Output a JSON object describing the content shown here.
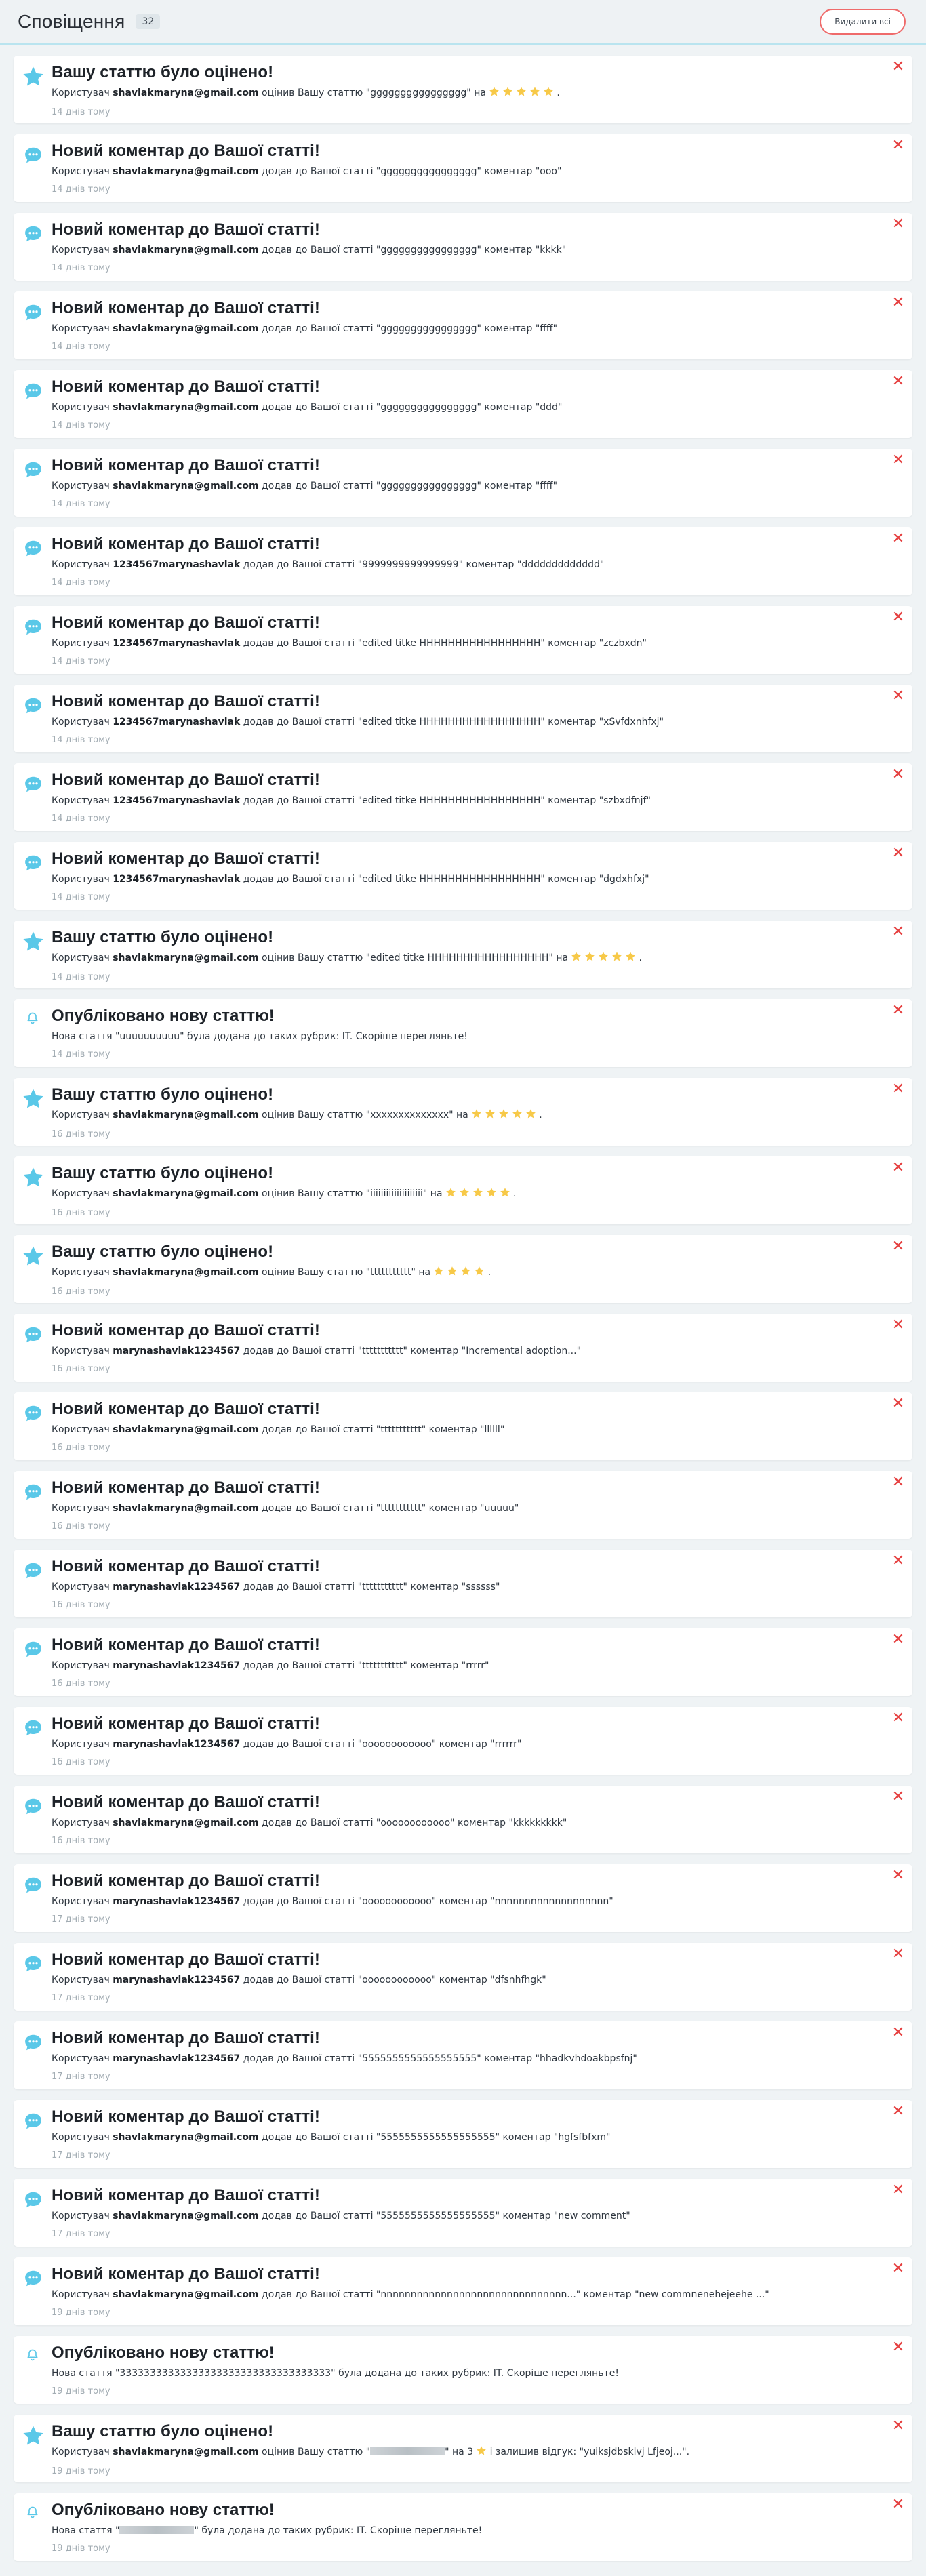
{
  "header": {
    "title": "Сповіщення",
    "count": "32",
    "delete_all": "Видалити всі"
  },
  "colors": {
    "accent": "#5ac8e8",
    "star": "#f7c948",
    "close": "#e53e3e",
    "delete_border": "#ef6b6b",
    "muted": "#a2acb3"
  },
  "notifications": [
    {
      "type": "rating",
      "icon": "star-icon",
      "title": "Вашу статтю було оцінено!",
      "pre": "Користувач",
      "user": "shavlakmaryna@gmail.com",
      "mid": "оцінив Вашу статтю \"gggggggggggggggg\" на",
      "stars": 5,
      "post": ".",
      "time": "14 днів тому"
    },
    {
      "type": "comment",
      "icon": "comment-icon",
      "title": "Новий коментар до Вашої статті!",
      "pre": "Користувач",
      "user": "shavlakmaryna@gmail.com",
      "mid": "додав до Вашої статті \"gggggggggggggggg\" коментар \"ooo\"",
      "time": "14 днів тому"
    },
    {
      "type": "comment",
      "icon": "comment-icon",
      "title": "Новий коментар до Вашої статті!",
      "pre": "Користувач",
      "user": "shavlakmaryna@gmail.com",
      "mid": "додав до Вашої статті \"gggggggggggggggg\" коментар \"kkkk\"",
      "time": "14 днів тому"
    },
    {
      "type": "comment",
      "icon": "comment-icon",
      "title": "Новий коментар до Вашої статті!",
      "pre": "Користувач",
      "user": "shavlakmaryna@gmail.com",
      "mid": "додав до Вашої статті \"gggggggggggggggg\" коментар \"ffff\"",
      "time": "14 днів тому"
    },
    {
      "type": "comment",
      "icon": "comment-icon",
      "title": "Новий коментар до Вашої статті!",
      "pre": "Користувач",
      "user": "shavlakmaryna@gmail.com",
      "mid": "додав до Вашої статті \"gggggggggggggggg\" коментар \"ddd\"",
      "time": "14 днів тому"
    },
    {
      "type": "comment",
      "icon": "comment-icon",
      "title": "Новий коментар до Вашої статті!",
      "pre": "Користувач",
      "user": "shavlakmaryna@gmail.com",
      "mid": "додав до Вашої статті \"gggggggggggggggg\" коментар \"ffff\"",
      "time": "14 днів тому"
    },
    {
      "type": "comment",
      "icon": "comment-icon",
      "title": "Новий коментар до Вашої статті!",
      "pre": "Користувач",
      "user": "1234567marynashavlak",
      "mid": "додав до Вашої статті \"9999999999999999\" коментар \"ddddddddddddd\"",
      "time": "14 днів тому"
    },
    {
      "type": "comment",
      "icon": "comment-icon",
      "title": "Новий коментар до Вашої статті!",
      "pre": "Користувач",
      "user": "1234567marynashavlak",
      "mid": "додав до Вашої статті \"edited titke HHHHHHHHHHHHHHHHH\" коментар \"zczbxdn\"",
      "time": "14 днів тому"
    },
    {
      "type": "comment",
      "icon": "comment-icon",
      "title": "Новий коментар до Вашої статті!",
      "pre": "Користувач",
      "user": "1234567marynashavlak",
      "mid": "додав до Вашої статті \"edited titke HHHHHHHHHHHHHHHHH\" коментар \"xSvfdxnhfxj\"",
      "time": "14 днів тому"
    },
    {
      "type": "comment",
      "icon": "comment-icon",
      "title": "Новий коментар до Вашої статті!",
      "pre": "Користувач",
      "user": "1234567marynashavlak",
      "mid": "додав до Вашої статті \"edited titke HHHHHHHHHHHHHHHHH\" коментар \"szbxdfnjf\"",
      "time": "14 днів тому"
    },
    {
      "type": "comment",
      "icon": "comment-icon",
      "title": "Новий коментар до Вашої статті!",
      "pre": "Користувач",
      "user": "1234567marynashavlak",
      "mid": "додав до Вашої статті \"edited titke HHHHHHHHHHHHHHHHH\" коментар \"dgdxhfxj\"",
      "time": "14 днів тому"
    },
    {
      "type": "rating",
      "icon": "star-icon",
      "title": "Вашу статтю було оцінено!",
      "pre": "Користувач",
      "user": "shavlakmaryna@gmail.com",
      "mid": "оцінив Вашу статтю \"edited titke HHHHHHHHHHHHHHHHH\" на",
      "stars": 5,
      "post": ".",
      "time": "14 днів тому"
    },
    {
      "type": "article",
      "icon": "bell-icon",
      "title": "Опубліковано нову статтю!",
      "pre": "Нова стаття \"uuuuuuuuuu\" була додана до таких рубрик: IT. Скоріше перегляньте!",
      "time": "14 днів тому"
    },
    {
      "type": "rating",
      "icon": "star-icon",
      "title": "Вашу статтю було оцінено!",
      "pre": "Користувач",
      "user": "shavlakmaryna@gmail.com",
      "mid": "оцінив Вашу статтю \"xxxxxxxxxxxxxx\" на",
      "stars": 5,
      "post": ".",
      "time": "16 днів тому"
    },
    {
      "type": "rating",
      "icon": "star-icon",
      "title": "Вашу статтю було оцінено!",
      "pre": "Користувач",
      "user": "shavlakmaryna@gmail.com",
      "mid": "оцінив Вашу статтю \"iiiiiiiiiiiiiiiiiiii\" на",
      "stars": 5,
      "post": ".",
      "time": "16 днів тому"
    },
    {
      "type": "rating",
      "icon": "star-icon",
      "title": "Вашу статтю було оцінено!",
      "pre": "Користувач",
      "user": "shavlakmaryna@gmail.com",
      "mid": "оцінив Вашу статтю \"ttttttttttt\" на",
      "stars": 4,
      "post": ".",
      "time": "16 днів тому"
    },
    {
      "type": "comment",
      "icon": "comment-icon",
      "title": "Новий коментар до Вашої статті!",
      "pre": "Користувач",
      "user": "marynashavlak1234567",
      "mid": "додав до Вашої статті \"ttttttttttt\" коментар \"Incremental adoption...\"",
      "time": "16 днів тому"
    },
    {
      "type": "comment",
      "icon": "comment-icon",
      "title": "Новий коментар до Вашої статті!",
      "pre": "Користувач",
      "user": "shavlakmaryna@gmail.com",
      "mid": "додав до Вашої статті \"ttttttttttt\" коментар \"llllll\"",
      "time": "16 днів тому"
    },
    {
      "type": "comment",
      "icon": "comment-icon",
      "title": "Новий коментар до Вашої статті!",
      "pre": "Користувач",
      "user": "shavlakmaryna@gmail.com",
      "mid": "додав до Вашої статті \"ttttttttttt\" коментар \"uuuuu\"",
      "time": "16 днів тому"
    },
    {
      "type": "comment",
      "icon": "comment-icon",
      "title": "Новий коментар до Вашої статті!",
      "pre": "Користувач",
      "user": "marynashavlak1234567",
      "mid": "додав до Вашої статті \"ttttttttttt\" коментар \"ssssss\"",
      "time": "16 днів тому"
    },
    {
      "type": "comment",
      "icon": "comment-icon",
      "title": "Новий коментар до Вашої статті!",
      "pre": "Користувач",
      "user": "marynashavlak1234567",
      "mid": "додав до Вашої статті \"ttttttttttt\" коментар \"rrrrr\"",
      "time": "16 днів тому"
    },
    {
      "type": "comment",
      "icon": "comment-icon",
      "title": "Новий коментар до Вашої статті!",
      "pre": "Користувач",
      "user": "marynashavlak1234567",
      "mid": "додав до Вашої статті \"oooooooooooo\" коментар \"rrrrrr\"",
      "time": "16 днів тому"
    },
    {
      "type": "comment",
      "icon": "comment-icon",
      "title": "Новий коментар до Вашої статті!",
      "pre": "Користувач",
      "user": "shavlakmaryna@gmail.com",
      "mid": "додав до Вашої статті \"oooooooooooo\" коментар \"kkkkkkkkk\"",
      "time": "16 днів тому"
    },
    {
      "type": "comment",
      "icon": "comment-icon",
      "title": "Новий коментар до Вашої статті!",
      "pre": "Користувач",
      "user": "marynashavlak1234567",
      "mid": "додав до Вашої статті \"oooooooooooo\" коментар \"nnnnnnnnnnnnnnnnnnn\"",
      "time": "17 днів тому"
    },
    {
      "type": "comment",
      "icon": "comment-icon",
      "title": "Новий коментар до Вашої статті!",
      "pre": "Користувач",
      "user": "marynashavlak1234567",
      "mid": "додав до Вашої статті \"oooooooooooo\" коментар \"dfsnhfhgk\"",
      "time": "17 днів тому"
    },
    {
      "type": "comment",
      "icon": "comment-icon",
      "title": "Новий коментар до Вашої статті!",
      "pre": "Користувач",
      "user": "marynashavlak1234567",
      "mid": "додав до Вашої статті \"5555555555555555555\" коментар \"hhadkvhdoakbpsfnj\"",
      "time": "17 днів тому"
    },
    {
      "type": "comment",
      "icon": "comment-icon",
      "title": "Новий коментар до Вашої статті!",
      "pre": "Користувач",
      "user": "shavlakmaryna@gmail.com",
      "mid": "додав до Вашої статті \"5555555555555555555\" коментар \"hgfsfbfxm\"",
      "time": "17 днів тому"
    },
    {
      "type": "comment",
      "icon": "comment-icon",
      "title": "Новий коментар до Вашої статті!",
      "pre": "Користувач",
      "user": "shavlakmaryna@gmail.com",
      "mid": "додав до Вашої статті \"5555555555555555555\" коментар \"new comment\"",
      "time": "17 днів тому"
    },
    {
      "type": "comment",
      "icon": "comment-icon",
      "title": "Новий коментар до Вашої статті!",
      "pre": "Користувач",
      "user": "shavlakmaryna@gmail.com",
      "mid": "додав до Вашої статті \"nnnnnnnnnnnnnnnnnnnnnnnnnnnnnnn...\" коментар \"new commnenehejeehe ...\"",
      "time": "19 днів тому"
    },
    {
      "type": "article",
      "icon": "bell-icon",
      "title": "Опубліковано нову статтю!",
      "pre": "Нова стаття \"33333333333333333333333333333333333\" була додана до таких рубрик: IT. Скоріше перегляньте!",
      "time": "19 днів тому"
    },
    {
      "type": "rating",
      "icon": "star-icon",
      "title": "Вашу статтю було оцінено!",
      "pre": "Користувач",
      "user": "shavlakmaryna@gmail.com",
      "mid": "оцінив Вашу статтю \"",
      "blur": true,
      "mid2": "\" на 3",
      "stars": 1,
      "post": "і залишив відгук: \"yuiksjdbsklvj Lfjeoj...\".",
      "time": "19 днів тому"
    },
    {
      "type": "article",
      "icon": "bell-icon",
      "title": "Опубліковано нову статтю!",
      "pre": "Нова стаття \"",
      "blur": true,
      "post": "\" була додана до таких рубрик: IT. Скоріше перегляньте!",
      "time": "19 днів тому"
    }
  ]
}
